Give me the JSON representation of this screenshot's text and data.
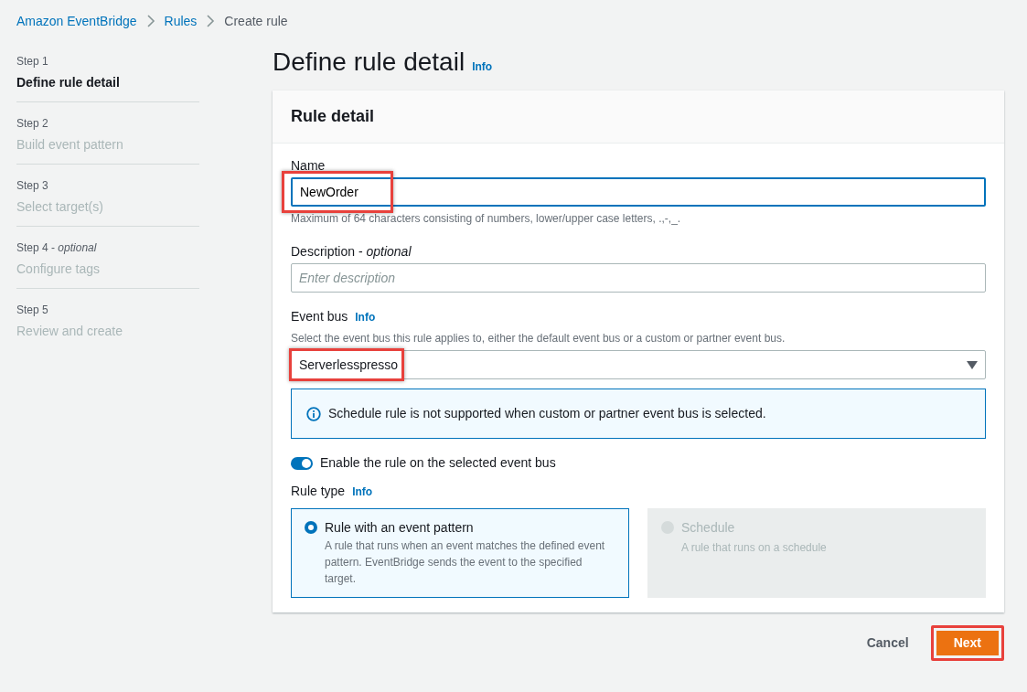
{
  "breadcrumb": [
    {
      "label": "Amazon EventBridge",
      "link": true
    },
    {
      "label": "Rules",
      "link": true
    },
    {
      "label": "Create rule",
      "link": false
    }
  ],
  "steps": [
    {
      "step": "Step 1",
      "label": "Define rule detail",
      "selected": true
    },
    {
      "step": "Step 2",
      "label": "Build event pattern",
      "selected": false
    },
    {
      "step": "Step 3",
      "label": "Select target(s)",
      "selected": false
    },
    {
      "step": "Step 4 - *optional*",
      "label": "Configure tags",
      "selected": false
    },
    {
      "step": "Step 5",
      "label": "Review and create",
      "selected": false
    }
  ],
  "page_title": "Define rule detail",
  "page_title_info": "Info",
  "card": {
    "title": "Rule detail",
    "name": {
      "label": "Name",
      "value": "NewOrder",
      "hint": "Maximum of 64 characters consisting of numbers, lower/upper case letters, .,-,_.",
      "focused": true,
      "highlighted": true
    },
    "description": {
      "label": "Description - *optional*",
      "placeholder": "Enter description"
    },
    "event_bus": {
      "label": "Event bus",
      "info": "Info",
      "hint": "Select the event bus this rule applies to, either the default event bus or a custom or partner event bus.",
      "value": "Serverlesspresso",
      "highlighted": true
    },
    "alert": {
      "text": "Schedule rule is not supported when custom or partner event bus is selected."
    },
    "enable_toggle": {
      "label": "Enable the rule on the selected event bus",
      "on": true
    },
    "rule_type": {
      "label": "Rule type",
      "info": "Info",
      "options": [
        {
          "title": "Rule with an event pattern",
          "description": "A rule that runs when an event matches the defined event pattern. EventBridge sends the event to the specified target.",
          "selected": true,
          "disabled": false
        },
        {
          "title": "Schedule",
          "description": "A rule that runs on a schedule",
          "selected": false,
          "disabled": true
        }
      ]
    }
  },
  "buttons": [
    {
      "label": "Cancel",
      "kind": "link",
      "highlighted": false
    },
    {
      "label": "Next",
      "kind": "primary",
      "highlighted": true
    }
  ]
}
